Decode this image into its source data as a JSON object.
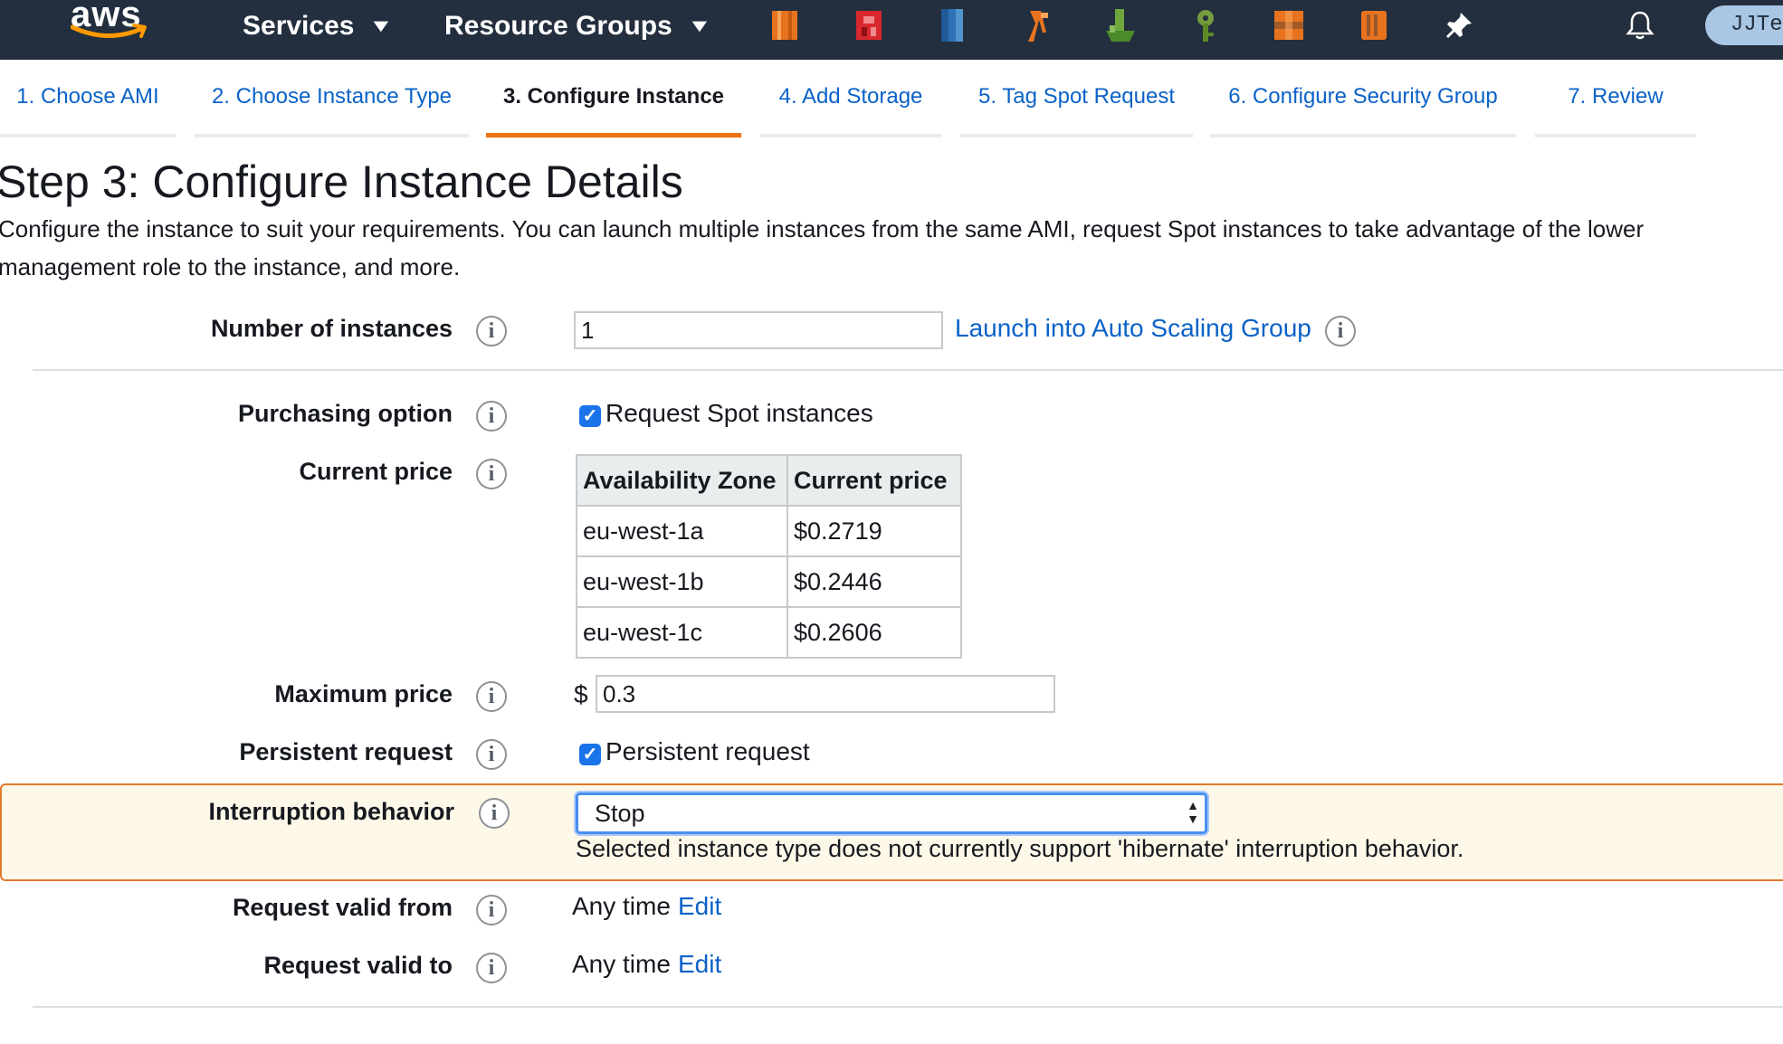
{
  "topnav": {
    "logo_text": "aws",
    "services_label": "Services",
    "resource_groups_label": "Resource Groups",
    "pinned_icons": [
      "ec2-icon",
      "s3-icon",
      "dynamodb-icon",
      "lambda-icon",
      "cloudformation-icon",
      "kms-icon",
      "batch-icon",
      "ecr-icon"
    ],
    "pin_icon": "pin-icon",
    "bell_icon": "bell-icon",
    "user_label": "JJTech",
    "colors": {
      "bar": "#232f3e",
      "orange": "#ec7211"
    }
  },
  "wizard": {
    "tabs": [
      {
        "label": "1. Choose AMI"
      },
      {
        "label": "2. Choose Instance Type"
      },
      {
        "label": "3. Configure Instance",
        "active": true
      },
      {
        "label": "4. Add Storage"
      },
      {
        "label": "5. Tag Spot Request"
      },
      {
        "label": "6. Configure Security Group"
      },
      {
        "label": "7. Review"
      }
    ]
  },
  "page": {
    "title": "Step 3: Configure Instance Details",
    "description_line1": "Configure the instance to suit your requirements. You can launch multiple instances from the same AMI, request Spot instances to take advantage of the lower",
    "description_line2": "management role to the instance, and more."
  },
  "form": {
    "number_of_instances": {
      "label": "Number of instances",
      "value": "1",
      "asg_link": "Launch into Auto Scaling Group"
    },
    "purchasing_option": {
      "label": "Purchasing option",
      "checkbox_label": "Request Spot instances",
      "checked": true
    },
    "current_price": {
      "label": "Current price",
      "headers": [
        "Availability Zone",
        "Current price"
      ],
      "rows": [
        [
          "eu-west-1a",
          "$0.2719"
        ],
        [
          "eu-west-1b",
          "$0.2446"
        ],
        [
          "eu-west-1c",
          "$0.2606"
        ]
      ]
    },
    "maximum_price": {
      "label": "Maximum price",
      "currency": "$",
      "value": "0.3"
    },
    "persistent_request": {
      "label": "Persistent request",
      "checkbox_label": "Persistent request",
      "checked": true
    },
    "interruption_behavior": {
      "label": "Interruption behavior",
      "selected": "Stop",
      "message": "Selected instance type does not currently support 'hibernate' interruption behavior."
    },
    "request_valid_from": {
      "label": "Request valid from",
      "value": "Any time",
      "edit": "Edit"
    },
    "request_valid_to": {
      "label": "Request valid to",
      "value": "Any time",
      "edit": "Edit"
    }
  }
}
